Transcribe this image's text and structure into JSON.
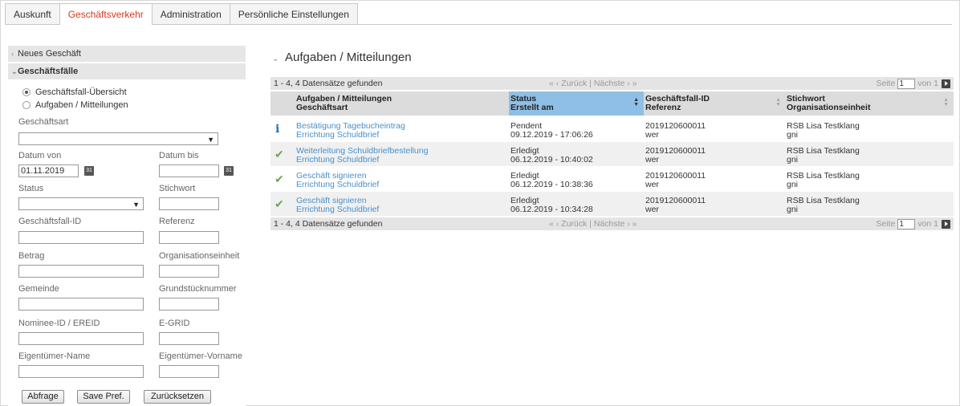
{
  "nav": {
    "tabs": [
      "Auskunft",
      "Geschäftsverkehr",
      "Administration",
      "Persönliche Einstellungen"
    ]
  },
  "sidebar": {
    "neues_geschaeft": "Neues Geschäft",
    "geschaeftsfaelle": "Geschäftsfälle",
    "radio_uebersicht": "Geschäftsfall-Übersicht",
    "radio_aufgaben": "Aufgaben / Mitteilungen",
    "labels": {
      "geschaeftsart": "Geschäftsart",
      "datum_von": "Datum von",
      "datum_bis": "Datum bis",
      "status": "Status",
      "stichwort": "Stichwort",
      "geschaeftsfall_id": "Geschäftsfall-ID",
      "referenz": "Referenz",
      "betrag": "Betrag",
      "organisationseinheit": "Organisationseinheit",
      "gemeinde": "Gemeinde",
      "grundstuecknummer": "Grundstücknummer",
      "nominee": "Nominee-ID / EREID",
      "egrid": "E-GRID",
      "eigentuemer_name": "Eigentümer-Name",
      "eigentuemer_vorname": "Eigentümer-Vorname"
    },
    "values": {
      "datum_von": "01.11.2019"
    },
    "buttons": {
      "abfrage": "Abfrage",
      "save": "Save Pref.",
      "reset": "Zurücksetzen"
    }
  },
  "main": {
    "title": "Aufgaben / Mitteilungen",
    "pager": {
      "count": "1 - 4, 4 Datensätze gefunden",
      "nav": "«   ‹ Zurück  |  Nächste ›   »",
      "seite": "Seite",
      "page": "1",
      "von": "von 1"
    },
    "columns": [
      {
        "l1": "Aufgaben / Mitteilungen",
        "l2": "Geschäftsart"
      },
      {
        "l1": "Status",
        "l2": "Erstellt am"
      },
      {
        "l1": "Geschäftsfall-ID",
        "l2": "Referenz"
      },
      {
        "l1": "Stichwort",
        "l2": "Organisationseinheit"
      }
    ],
    "rows": [
      {
        "icon": "info-icon",
        "title": "Bestätigung Tagebucheintrag",
        "art": "Errichtung Schuldbrief",
        "status": "Pendent",
        "date": "09.12.2019 - 17:06:26",
        "id": "2019120600011",
        "ref": "wer",
        "stichwort": "RSB Lisa Testklang",
        "org": "gni"
      },
      {
        "icon": "check-icon",
        "title": "Weiterleitung Schuldbriefbestellung",
        "art": "Errichtung Schuldbrief",
        "status": "Erledigt",
        "date": "06.12.2019 - 10:40:02",
        "id": "2019120600011",
        "ref": "wer",
        "stichwort": "RSB Lisa Testklang",
        "org": "gni"
      },
      {
        "icon": "check-icon",
        "title": "Geschäft signieren",
        "art": "Errichtung Schuldbrief",
        "status": "Erledigt",
        "date": "06.12.2019 - 10:38:36",
        "id": "2019120600011",
        "ref": "wer",
        "stichwort": "RSB Lisa Testklang",
        "org": "gni"
      },
      {
        "icon": "check-icon",
        "title": "Geschäft signieren",
        "art": "Errichtung Schuldbrief",
        "status": "Erledigt",
        "date": "06.12.2019 - 10:34:28",
        "id": "2019120600011",
        "ref": "wer",
        "stichwort": "RSB Lisa Testklang",
        "org": "gni"
      }
    ]
  }
}
